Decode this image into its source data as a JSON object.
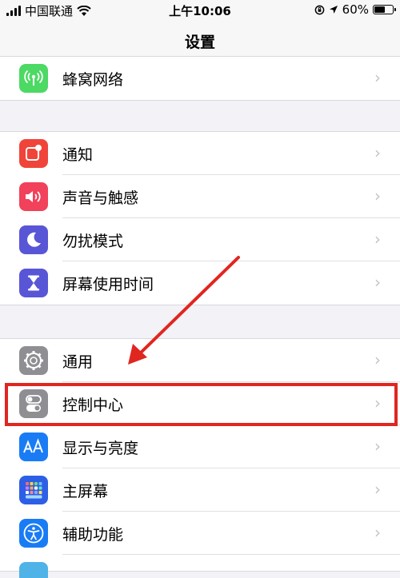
{
  "status_bar": {
    "carrier": "中国联通",
    "time": "上午10:06",
    "battery_percent": "60%",
    "battery_level": 0.6
  },
  "nav": {
    "title": "设置"
  },
  "groups": [
    {
      "items": [
        {
          "label": "蜂窝网络",
          "icon": "antenna-icon",
          "color": "#4cd964"
        }
      ]
    },
    {
      "items": [
        {
          "label": "通知",
          "icon": "notification-icon",
          "color": "#f0443a"
        },
        {
          "label": "声音与触感",
          "icon": "speaker-icon",
          "color": "#f2415a"
        },
        {
          "label": "勿扰模式",
          "icon": "moon-icon",
          "color": "#5856d6"
        },
        {
          "label": "屏幕使用时间",
          "icon": "hourglass-icon",
          "color": "#5856d6"
        }
      ]
    },
    {
      "items": [
        {
          "label": "通用",
          "icon": "gear-icon",
          "color": "#8e8e93"
        },
        {
          "label": "控制中心",
          "icon": "toggle-icon",
          "color": "#8e8e93"
        },
        {
          "label": "显示与亮度",
          "icon": "text-size-icon",
          "color": "#1a7cf5"
        },
        {
          "label": "主屏幕",
          "icon": "home-screen-icon",
          "color": "#2d5fe6"
        },
        {
          "label": "辅助功能",
          "icon": "accessibility-icon",
          "color": "#1a7cf5"
        }
      ]
    }
  ],
  "chevron": "›",
  "annotation": {
    "highlighted_item": "控制中心",
    "highlight_color": "#e0261f"
  }
}
